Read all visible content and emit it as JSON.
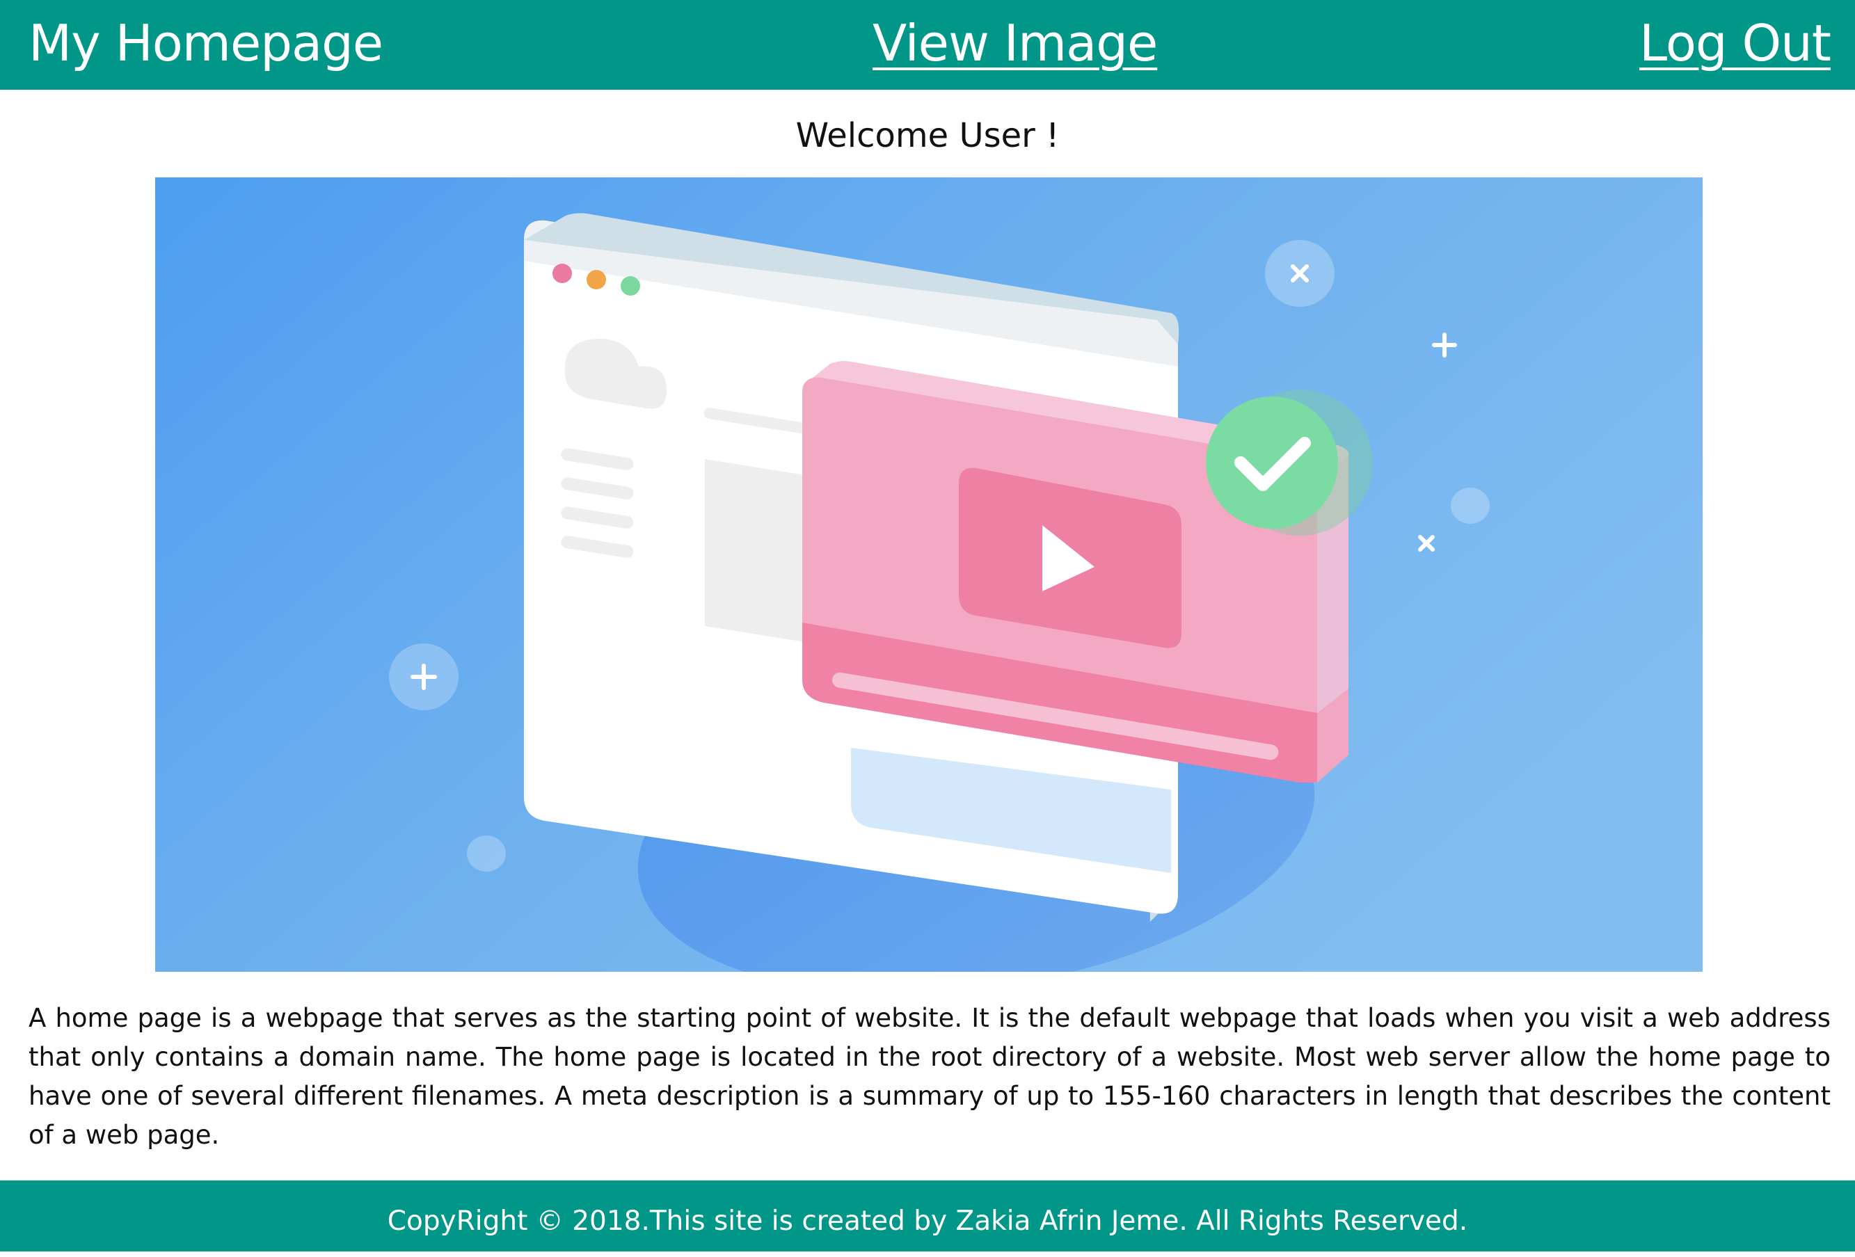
{
  "header": {
    "site_title": "My Homepage",
    "view_image_link": "View Image",
    "log_out_link": "Log Out",
    "background_color": "#009688"
  },
  "main": {
    "welcome_text": "Welcome User !",
    "description": "A home page is a webpage that serves as the starting point of website. It is the default webpage that loads when you visit a web address that only contains a domain name. The home page is located in the root directory of a website. Most web server allow the home page to have one of several different filenames. A meta description is a summary of up to 155-160 characters in length that describes the content of a web page."
  },
  "footer": {
    "copyright": "CopyRight © 2018.This site is created by Zakia Afrin Jeme. All Rights Reserved.",
    "background_color": "#009688"
  },
  "icons": [
    "play-icon",
    "checkmark-icon",
    "plus-icon",
    "close-icon"
  ]
}
